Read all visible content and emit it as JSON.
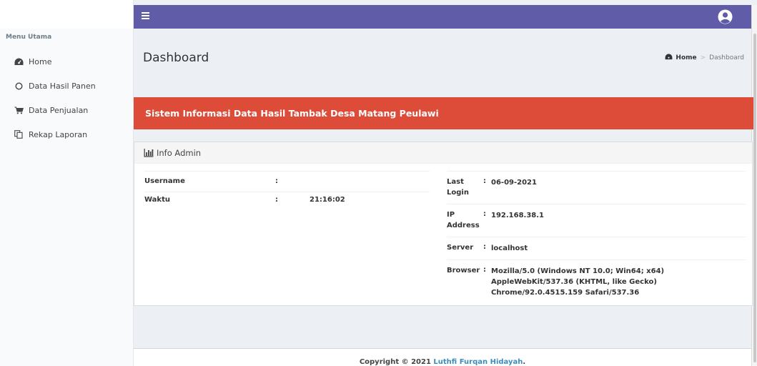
{
  "sidebar": {
    "header": "Menu Utama",
    "items": [
      {
        "label": "Home",
        "icon": "dashboard-icon"
      },
      {
        "label": "Data Hasil Panen",
        "icon": "circle-icon"
      },
      {
        "label": "Data Penjualan",
        "icon": "shopping-cart-icon"
      },
      {
        "label": "Rekap Laporan",
        "icon": "copy-icon"
      }
    ]
  },
  "topbar": {
    "color": "#605ca8",
    "menu_icon": "hamburger-icon",
    "user_icon": "user-circle-icon"
  },
  "header": {
    "title": "Dashboard",
    "breadcrumb": {
      "home": "Home",
      "separator": ">",
      "current": "Dashboard"
    }
  },
  "banner": {
    "text": "Sistem Informasi Data Hasil Tambak Desa Matang Peulawi",
    "color": "#dd4b39"
  },
  "info_box": {
    "title": "Info Admin",
    "left": [
      {
        "label": "Username",
        "colon": ":",
        "value": ""
      },
      {
        "label": "Waktu",
        "colon": ":",
        "value": "21:16:02"
      }
    ],
    "right": [
      {
        "label": "Last Login",
        "colon": ":",
        "value": "06-09-2021"
      },
      {
        "label": "IP Address",
        "colon": ":",
        "value": "192.168.38.1"
      },
      {
        "label": "Server",
        "colon": ":",
        "value": "localhost"
      },
      {
        "label": "Browser",
        "colon": ":",
        "value": "Mozilla/5.0 (Windows NT 10.0; Win64; x64) AppleWebKit/537.36 (KHTML, like Gecko) Chrome/92.0.4515.159 Safari/537.36"
      }
    ]
  },
  "footer": {
    "text": "Copyright © 2021 ",
    "author": "Luthfi Furqan Hidayah",
    "suffix": "."
  }
}
